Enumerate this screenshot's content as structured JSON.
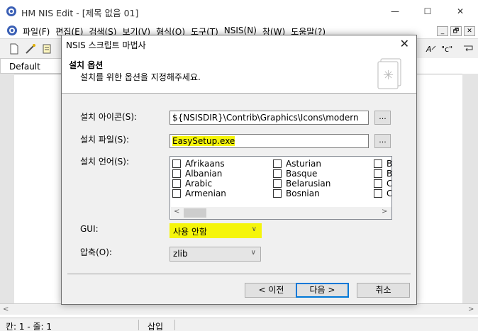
{
  "window": {
    "title": "HM NIS Edit - [제목 없음 01]",
    "minimize": "—",
    "maximize": "☐",
    "close": "✕"
  },
  "menubar": {
    "items": [
      "파일(F)",
      "편집(E)",
      "검색(S)",
      "보기(V)",
      "형식(O)",
      "도구(T)",
      "NSIS(N)",
      "창(W)",
      "도움말(?)"
    ],
    "mdi_min": "_",
    "mdi_restore": "🗗",
    "mdi_close": "✕"
  },
  "toolbar": {
    "right_text": "\"c\""
  },
  "editor": {
    "combo_value": "Default"
  },
  "statusbar": {
    "position": "칸: 1 - 줄: 1",
    "mode": "삽입"
  },
  "dialog": {
    "title": "NSIS 스크립트 마법사",
    "close": "✕",
    "header_title": "설치 옵션",
    "header_subtitle": "설치를 위한 옵션을 지정해주세요.",
    "icon_label": "설치 아이콘(S):",
    "icon_value": "${NSISDIR}\\Contrib\\Graphics\\Icons\\modern",
    "icon_browse": "...",
    "file_label": "설치 파일(S):",
    "file_value": "EasySetup.exe",
    "file_browse": "...",
    "lang_label": "설치 언어(S):",
    "languages": {
      "col1": [
        "Afrikaans",
        "Albanian",
        "Arabic",
        "Armenian"
      ],
      "col2": [
        "Asturian",
        "Basque",
        "Belarusian",
        "Bosnian"
      ],
      "col3": [
        "B",
        "B",
        "C",
        "C"
      ]
    },
    "gui_label": "GUI:",
    "gui_value": "사용 안함",
    "compress_label": "압축(O):",
    "compress_value": "zlib",
    "back_button": "< 이전",
    "next_button": "다음 >",
    "cancel_button": "취소"
  }
}
